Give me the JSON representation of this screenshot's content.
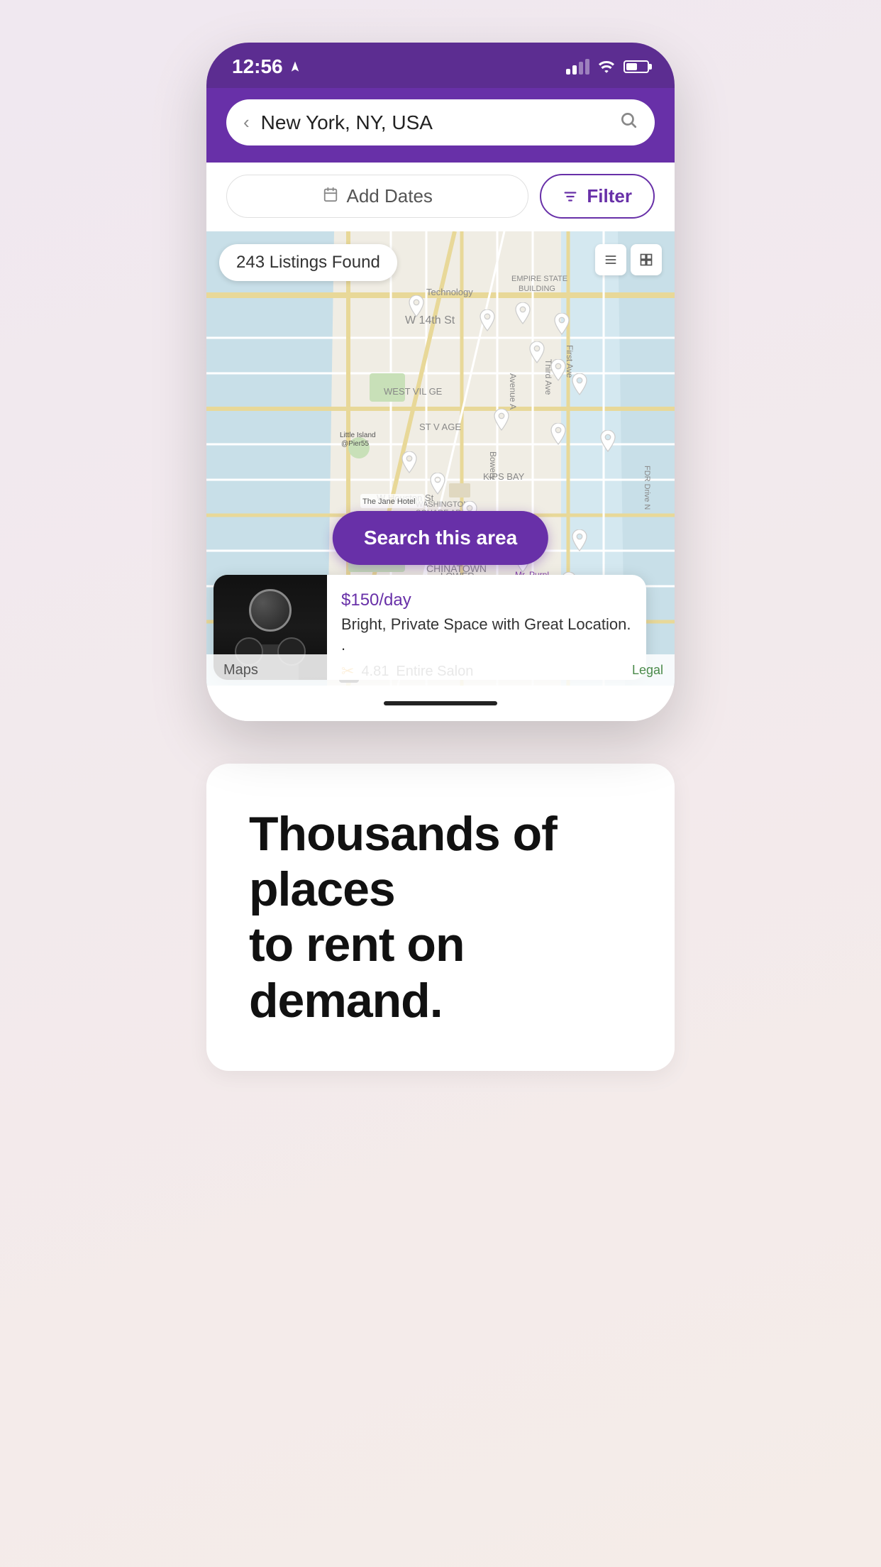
{
  "status_bar": {
    "time": "12:56",
    "location_arrow": "◂"
  },
  "search_bar": {
    "location": "New York, NY, USA",
    "back_label": "‹",
    "search_placeholder": "Search"
  },
  "filter_row": {
    "add_dates_label": "Add Dates",
    "filter_label": "Filter"
  },
  "map": {
    "listings_count": "243 Listings Found",
    "search_area_button": "Search this area"
  },
  "listing_card": {
    "price": "$150",
    "per": "/day",
    "name": "Bright, Private Space with Great Location. .",
    "rating": "4.81",
    "type": "Entire Salon"
  },
  "maps_footer": {
    "brand": "Maps",
    "legal": "Legal"
  },
  "promo": {
    "line1": "Thousands of places",
    "line2": "to rent on demand."
  },
  "icons": {
    "back": "‹",
    "search": "🔍",
    "calendar": "📅",
    "filter": "⚙",
    "list_view": "≡",
    "grid_view": "⊞",
    "apple": "",
    "person": "✂"
  }
}
